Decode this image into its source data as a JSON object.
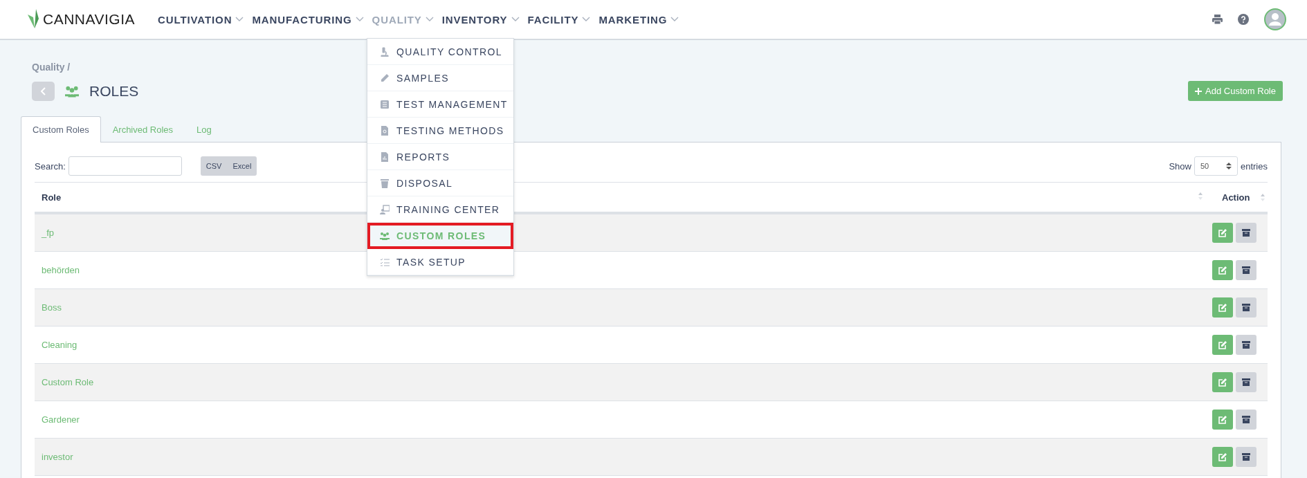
{
  "header": {
    "logo": "CANNAVIGIA",
    "nav": [
      {
        "label": "CULTIVATION",
        "selected": false
      },
      {
        "label": "MANUFACTURING",
        "selected": false
      },
      {
        "label": "QUALITY",
        "selected": true
      },
      {
        "label": "INVENTORY",
        "selected": false
      },
      {
        "label": "FACILITY",
        "selected": false
      },
      {
        "label": "MARKETING",
        "selected": false
      }
    ]
  },
  "dropdown": {
    "items": [
      {
        "label": "QUALITY CONTROL",
        "kind": "microscope",
        "selected": false,
        "highlighted": false
      },
      {
        "label": "SAMPLES",
        "kind": "tube",
        "selected": false,
        "highlighted": false
      },
      {
        "label": "TEST MANAGEMENT",
        "kind": "list",
        "selected": false,
        "highlighted": false
      },
      {
        "label": "TESTING METHODS",
        "kind": "filesearch",
        "selected": false,
        "highlighted": false
      },
      {
        "label": "REPORTS",
        "kind": "filechart",
        "selected": false,
        "highlighted": false
      },
      {
        "label": "DISPOSAL",
        "kind": "trash",
        "selected": false,
        "highlighted": false
      },
      {
        "label": "TRAINING CENTER",
        "kind": "teacher",
        "selected": false,
        "highlighted": false
      },
      {
        "label": "CUSTOM ROLES",
        "kind": "users",
        "selected": true,
        "highlighted": true
      },
      {
        "label": "TASK SETUP",
        "kind": "tasks",
        "selected": false,
        "highlighted": false
      }
    ]
  },
  "page": {
    "breadcrumb": "Quality /",
    "title": "ROLES",
    "add_button": "Add Custom Role"
  },
  "tabs": [
    {
      "label": "Custom Roles",
      "selected": true
    },
    {
      "label": "Archived Roles",
      "selected": false
    },
    {
      "label": "Log",
      "selected": false
    }
  ],
  "toolbar": {
    "search_label": "Search:",
    "export_buttons": [
      "CSV",
      "Excel"
    ],
    "show_label": "Show",
    "page_size": "50",
    "entries_label": "entries"
  },
  "table": {
    "columns": [
      "Role",
      "Action"
    ],
    "rows": [
      {
        "role": "_fp"
      },
      {
        "role": "behörden"
      },
      {
        "role": "Boss"
      },
      {
        "role": "Cleaning"
      },
      {
        "role": "Custom Role"
      },
      {
        "role": "Gardener"
      },
      {
        "role": "investor"
      }
    ]
  }
}
